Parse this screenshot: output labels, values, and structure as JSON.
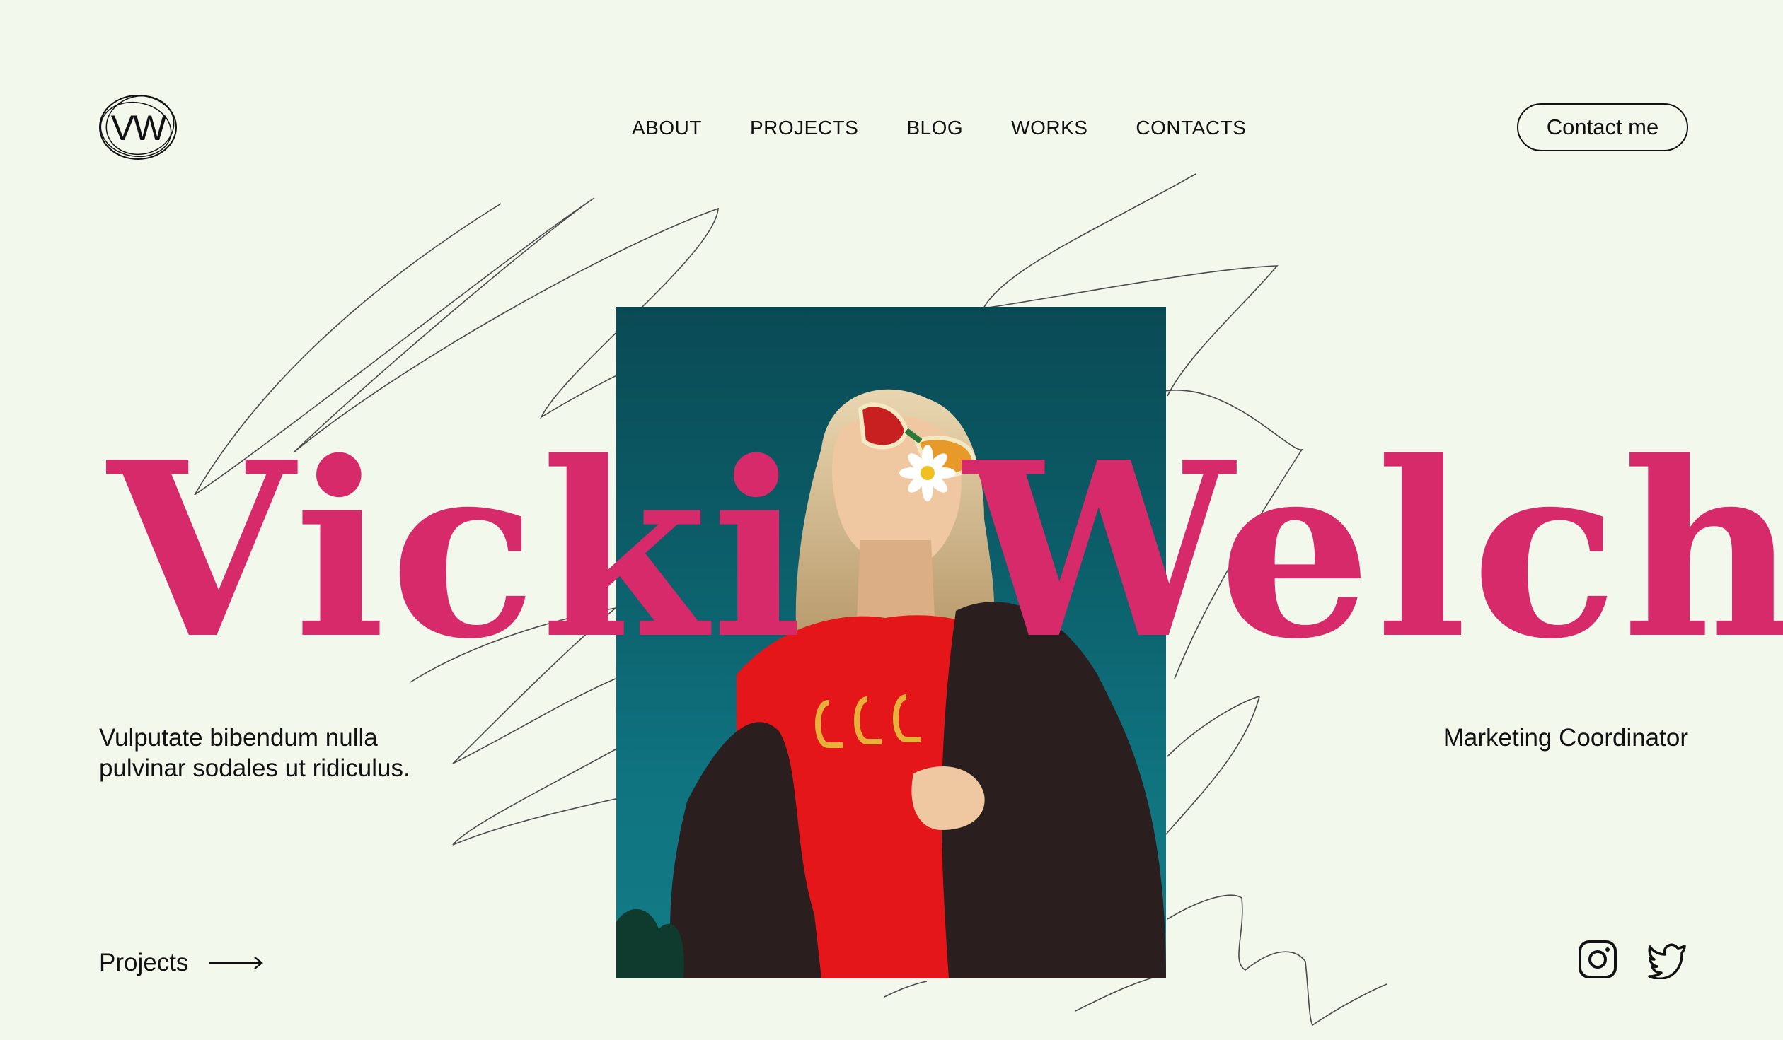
{
  "header": {
    "logo_text": "VW",
    "nav": [
      "ABOUT",
      "PROJECTS",
      "BLOG",
      "WORKS",
      "CONTACTS"
    ],
    "cta_label": "Contact me"
  },
  "hero": {
    "first_name": "Vicki",
    "last_name": "Welch",
    "tagline_line1": "Vulputate bibendum nulla",
    "tagline_line2": "pulvinar sodales ut ridiculus.",
    "role": "Marketing Coordinator",
    "projects_link": "Projects",
    "photo_icon": "portrait-photo"
  },
  "social": {
    "icons": [
      "instagram-icon",
      "twitter-icon"
    ]
  },
  "colors": {
    "background": "#f2f8ec",
    "accent": "#d62a6a",
    "text": "#111111"
  }
}
